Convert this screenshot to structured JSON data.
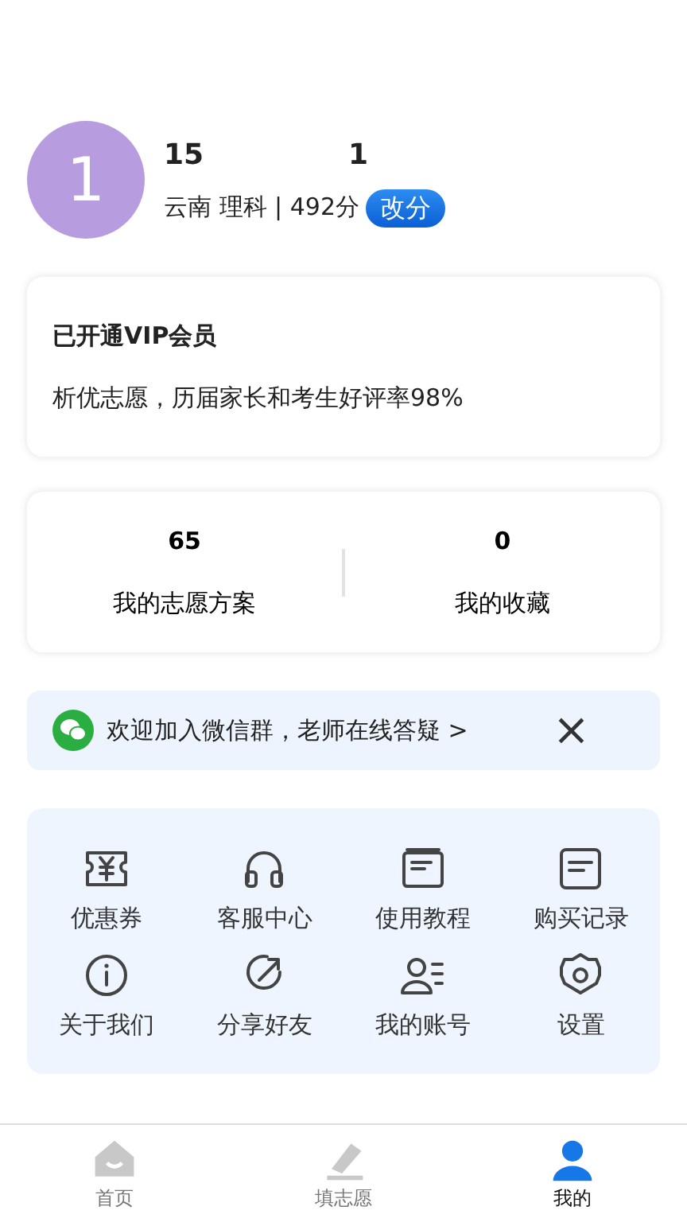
{
  "profile": {
    "avatar": "1",
    "stats": [
      "15",
      "1"
    ],
    "info": "云南 理科 | 492分",
    "edit_button": "改分"
  },
  "vip_card": {
    "title": "已开通VIP会员",
    "text": "析优志愿，历届家长和考生好评率98%"
  },
  "counts": [
    {
      "value": "65",
      "label": "我的志愿方案"
    },
    {
      "value": "0",
      "label": "我的收藏"
    }
  ],
  "banner": {
    "text": "欢迎加入微信群，老师在线答疑 >",
    "close": "×"
  },
  "menu": [
    {
      "label": "优惠券"
    },
    {
      "label": "客服中心"
    },
    {
      "label": "使用教程"
    },
    {
      "label": "购买记录"
    },
    {
      "label": "关于我们"
    },
    {
      "label": "分享好友"
    },
    {
      "label": "我的账号"
    },
    {
      "label": "设置"
    }
  ],
  "tab_bar": [
    {
      "label": "首页",
      "selected": false
    },
    {
      "label": "填志愿",
      "selected": false
    },
    {
      "label": "我的",
      "selected": true
    }
  ]
}
